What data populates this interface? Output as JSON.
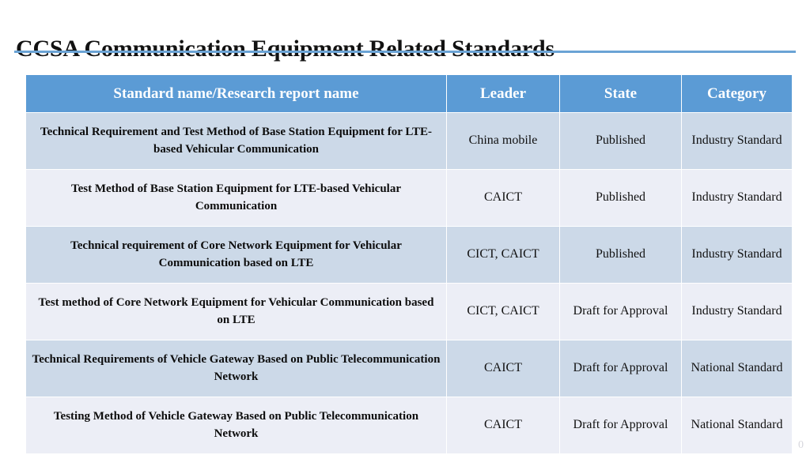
{
  "slide": {
    "title": "CCSA Communication Equipment Related Standards",
    "page_number": "0",
    "accent_color": "#5b9bd5",
    "rule_color": "#6aa3d5",
    "row_dark_color": "#ccd9e8",
    "row_light_color": "#eceef6"
  },
  "table": {
    "headers": [
      "Standard name/Research report name",
      "Leader",
      "State",
      "Category"
    ],
    "rows": [
      {
        "name": "Technical Requirement and Test Method of Base Station Equipment for LTE-based Vehicular Communication",
        "leader": "China mobile",
        "state": "Published",
        "category": "Industry Standard"
      },
      {
        "name": "Test Method of Base Station Equipment for LTE-based Vehicular Communication",
        "leader": "CAICT",
        "state": "Published",
        "category": "Industry Standard"
      },
      {
        "name": "Technical requirement of Core Network Equipment for Vehicular Communication based on LTE",
        "leader": "CICT, CAICT",
        "state": "Published",
        "category": "Industry Standard"
      },
      {
        "name": "Test method of Core Network Equipment for Vehicular Communication based on LTE",
        "leader": "CICT, CAICT",
        "state": "Draft for Approval",
        "category": "Industry Standard"
      },
      {
        "name": "Technical Requirements of Vehicle Gateway Based on Public Telecommunication Network",
        "leader": "CAICT",
        "state": "Draft for Approval",
        "category": "National Standard"
      },
      {
        "name": "Testing Method of Vehicle Gateway Based on Public Telecommunication Network",
        "leader": "CAICT",
        "state": "Draft for Approval",
        "category": "National Standard"
      }
    ]
  }
}
